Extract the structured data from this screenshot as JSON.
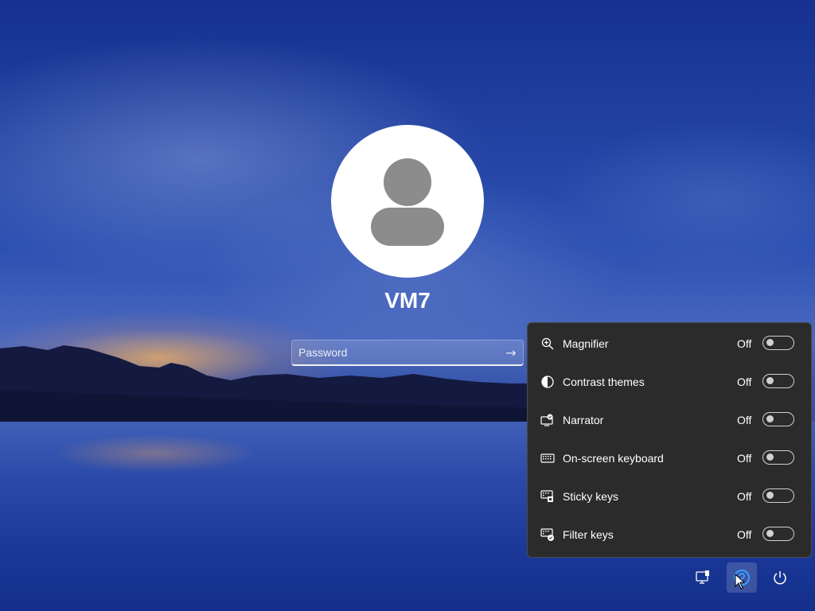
{
  "user": {
    "name": "VM7"
  },
  "password": {
    "placeholder": "Password",
    "submit_glyph": "→"
  },
  "accessibility": {
    "items": [
      {
        "label": "Magnifier",
        "state": "Off",
        "icon": "magnifier-icon"
      },
      {
        "label": "Contrast themes",
        "state": "Off",
        "icon": "contrast-icon"
      },
      {
        "label": "Narrator",
        "state": "Off",
        "icon": "narrator-icon"
      },
      {
        "label": "On-screen keyboard",
        "state": "Off",
        "icon": "keyboard-icon"
      },
      {
        "label": "Sticky keys",
        "state": "Off",
        "icon": "sticky-keys-icon"
      },
      {
        "label": "Filter keys",
        "state": "Off",
        "icon": "filter-keys-icon"
      }
    ]
  },
  "tray": {
    "buttons": [
      {
        "icon": "network-icon"
      },
      {
        "icon": "accessibility-icon",
        "active": true
      },
      {
        "icon": "power-icon"
      }
    ]
  },
  "colors": {
    "flyout_bg": "#2b2b2b",
    "accent_blue": "#3aa0ff",
    "wallpaper_deep_blue": "#0f2c8a"
  }
}
